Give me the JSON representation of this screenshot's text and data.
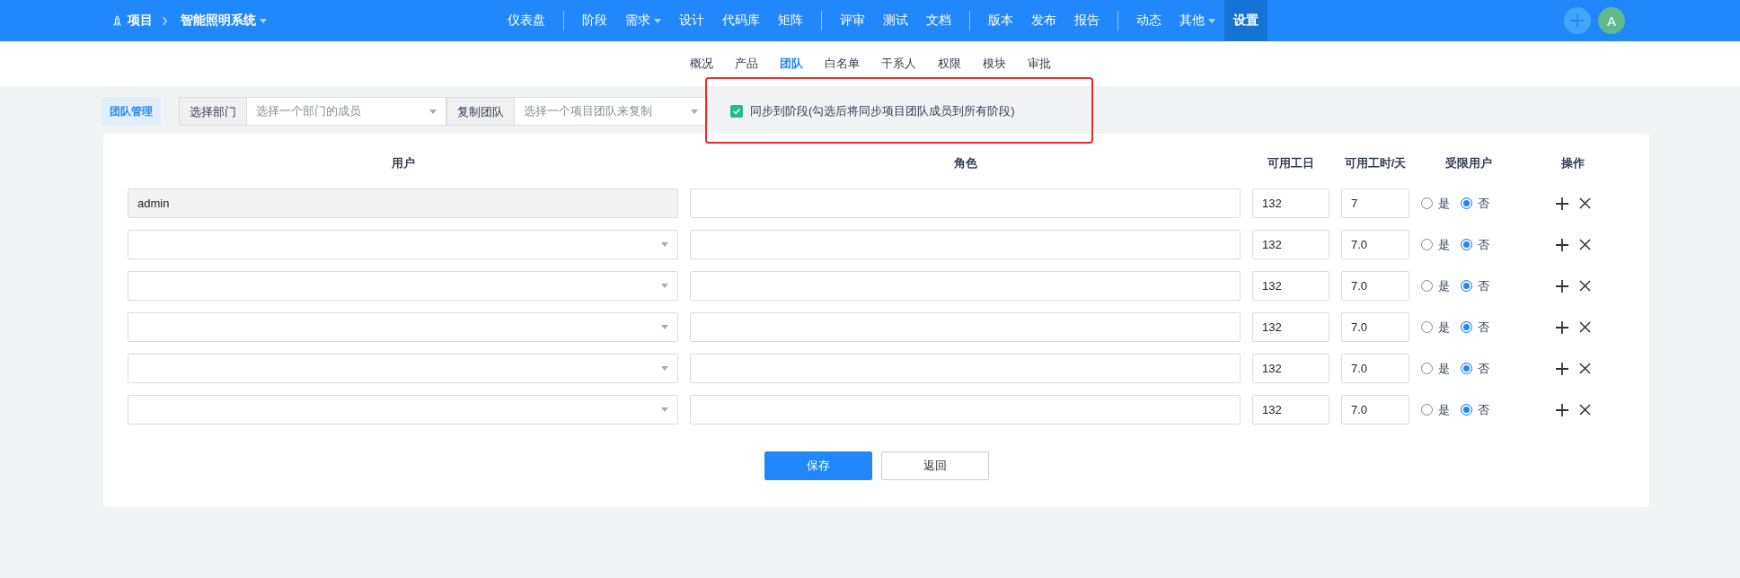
{
  "breadcrumb": {
    "root": "项目",
    "project": "智能照明系统"
  },
  "nav_groups": [
    [
      {
        "label": "仪表盘",
        "has_caret": false,
        "selected": false
      }
    ],
    [
      {
        "label": "阶段",
        "has_caret": false,
        "selected": false
      },
      {
        "label": "需求",
        "has_caret": true,
        "selected": false
      },
      {
        "label": "设计",
        "has_caret": false,
        "selected": false
      },
      {
        "label": "代码库",
        "has_caret": false,
        "selected": false
      },
      {
        "label": "矩阵",
        "has_caret": false,
        "selected": false
      }
    ],
    [
      {
        "label": "评审",
        "has_caret": false,
        "selected": false
      },
      {
        "label": "测试",
        "has_caret": false,
        "selected": false
      },
      {
        "label": "文档",
        "has_caret": false,
        "selected": false
      }
    ],
    [
      {
        "label": "版本",
        "has_caret": false,
        "selected": false
      },
      {
        "label": "发布",
        "has_caret": false,
        "selected": false
      },
      {
        "label": "报告",
        "has_caret": false,
        "selected": false
      }
    ],
    [
      {
        "label": "动态",
        "has_caret": false,
        "selected": false
      },
      {
        "label": "其他",
        "has_caret": true,
        "selected": false
      },
      {
        "label": "设置",
        "has_caret": false,
        "selected": true
      }
    ]
  ],
  "avatar": "A",
  "tabs": [
    {
      "label": "概况",
      "selected": false
    },
    {
      "label": "产品",
      "selected": false
    },
    {
      "label": "团队",
      "selected": true
    },
    {
      "label": "白名单",
      "selected": false
    },
    {
      "label": "干系人",
      "selected": false
    },
    {
      "label": "权限",
      "selected": false
    },
    {
      "label": "模块",
      "selected": false
    },
    {
      "label": "审批",
      "selected": false
    }
  ],
  "toolbar": {
    "title": "团队管理",
    "dept_label": "选择部门",
    "dept_placeholder": "选择一个部门的成员",
    "copy_label": "复制团队",
    "copy_placeholder": "选择一个项目团队来复制"
  },
  "sync": {
    "label": "同步到阶段(勾选后将同步项目团队成员到所有阶段)",
    "checked": true,
    "highlighted": true
  },
  "table": {
    "columns": [
      "用户",
      "角色",
      "可用工日",
      "可用工时/天",
      "受限用户",
      "操作"
    ],
    "rows": [
      {
        "kind": "text",
        "user": "admin",
        "days": "132",
        "hours": "7",
        "limited": [
          {
            "label": "是",
            "selected": false
          },
          {
            "label": "否",
            "selected": true
          }
        ]
      },
      {
        "kind": "select",
        "days": "132",
        "hours": "7.0",
        "limited": [
          {
            "label": "是",
            "selected": false
          },
          {
            "label": "否",
            "selected": true
          }
        ]
      },
      {
        "kind": "select",
        "days": "132",
        "hours": "7.0",
        "limited": [
          {
            "label": "是",
            "selected": false
          },
          {
            "label": "否",
            "selected": true
          }
        ]
      },
      {
        "kind": "select",
        "days": "132",
        "hours": "7.0",
        "limited": [
          {
            "label": "是",
            "selected": false
          },
          {
            "label": "否",
            "selected": true
          }
        ]
      },
      {
        "kind": "select",
        "days": "132",
        "hours": "7.0",
        "limited": [
          {
            "label": "是",
            "selected": false
          },
          {
            "label": "否",
            "selected": true
          }
        ]
      },
      {
        "kind": "select",
        "days": "132",
        "hours": "7.0",
        "limited": [
          {
            "label": "是",
            "selected": false
          },
          {
            "label": "否",
            "selected": true
          }
        ]
      }
    ]
  },
  "buttons": {
    "save": "保存",
    "back": "返回"
  }
}
